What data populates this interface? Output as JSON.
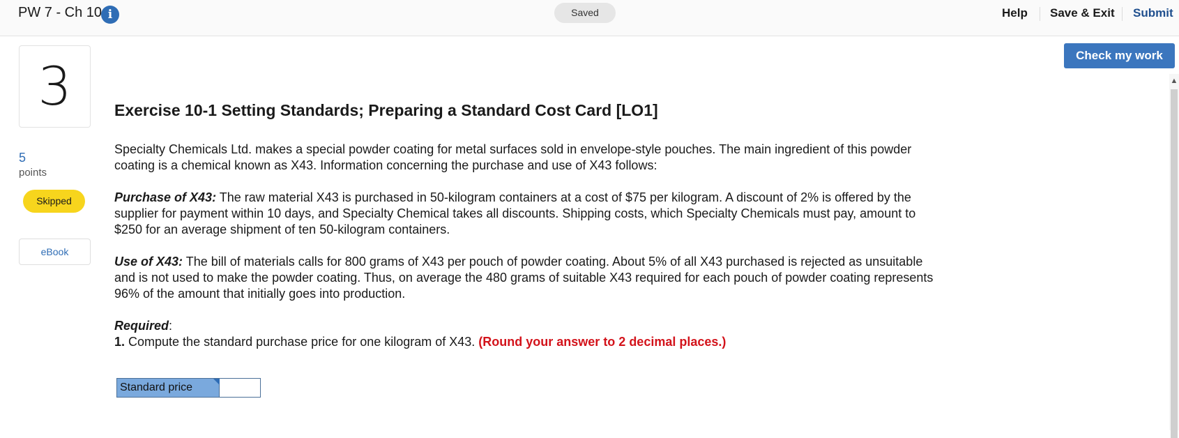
{
  "header": {
    "assignment_title": "PW 7 - Ch 10",
    "info_icon": "info-icon",
    "saved_status": "Saved",
    "help_label": "Help",
    "save_exit_label": "Save & Exit",
    "submit_label": "Submit"
  },
  "question": {
    "number": "3",
    "points_value": "5",
    "points_label": "points",
    "status_badge": "Skipped",
    "ebook_label": "eBook",
    "check_button": "Check my work"
  },
  "exercise": {
    "title": "Exercise 10-1 Setting Standards; Preparing a Standard Cost Card [LO1]",
    "intro": "Specialty Chemicals Ltd. makes a special powder coating for metal surfaces sold in envelope-style pouches. The main ingredient of this powder coating is a chemical known as X43. Information concerning the purchase and use of X43 follows:",
    "purchase_lead": "Purchase of X43:",
    "purchase_text": " The raw material X43 is purchased in 50-kilogram containers at a cost of $75 per kilogram. A discount of 2% is offered by the supplier for payment within 10 days, and Specialty Chemical takes all discounts. Shipping costs, which Specialty Chemicals must pay, amount to $250 for an average shipment of ten 50-kilogram containers.",
    "use_lead": "Use of X43:",
    "use_text": " The bill of materials calls for 800 grams of X43 per pouch of powder coating. About 5% of all X43 purchased is rejected as unsuitable and is not used to make the powder coating. Thus, on average the 480 grams of suitable X43 required for each pouch of powder coating represents 96% of the amount that initially goes into production.",
    "required_lead": "Required",
    "required_colon": ":",
    "req1_num": "1.",
    "req1_text": " Compute the standard purchase price for one kilogram of X43. ",
    "req1_note": "(Round your answer to 2 decimal places.)"
  },
  "answer": {
    "label": "Standard price",
    "value": ""
  },
  "colors": {
    "accent": "#3b76be",
    "badge": "#f7d51d",
    "note": "#d3131b",
    "label_bg": "#7aa9dd"
  }
}
